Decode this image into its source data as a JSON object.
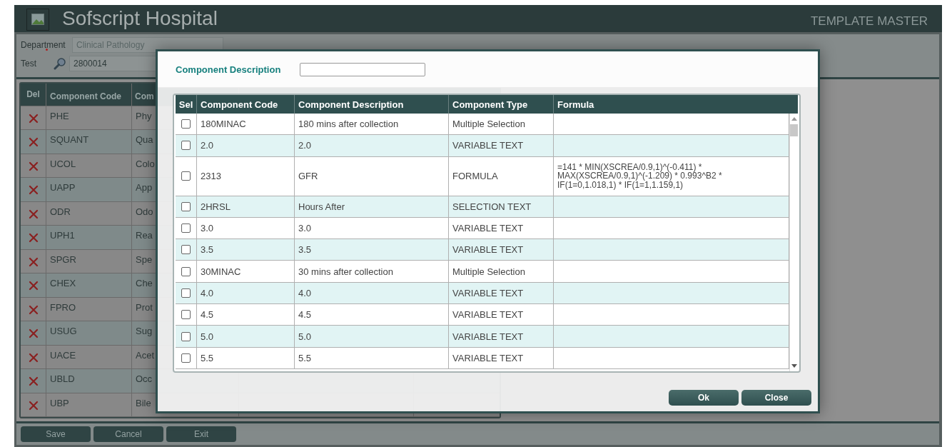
{
  "app": {
    "title": "Sofscript Hospital",
    "screen": "TEMPLATE MASTER"
  },
  "form": {
    "department": {
      "label": "Department",
      "required": true,
      "value": "Clinical Pathology"
    },
    "test": {
      "label": "Test",
      "value": "2800014"
    }
  },
  "component_table": {
    "columns": [
      "Del",
      "Component Code",
      "Com"
    ],
    "rows": [
      {
        "code": "PHE",
        "description": "Phy"
      },
      {
        "code": "SQUANT",
        "description": "Qua"
      },
      {
        "code": "UCOL",
        "description": "Colo"
      },
      {
        "code": "UAPP",
        "description": "App"
      },
      {
        "code": "ODR",
        "description": "Odo"
      },
      {
        "code": "UPH1",
        "description": "Rea"
      },
      {
        "code": "SPGR",
        "description": "Spe"
      },
      {
        "code": "CHEX",
        "description": "Che"
      },
      {
        "code": "FPRO",
        "description": "Prot"
      },
      {
        "code": "USUG",
        "description": "Sug"
      },
      {
        "code": "UACE",
        "description": "Acet"
      },
      {
        "code": "UBLD",
        "description": "Occ"
      },
      {
        "code": "UBP",
        "description": "Bile"
      }
    ]
  },
  "buttons": [
    "Save",
    "Cancel",
    "Exit"
  ],
  "dialog": {
    "filter": {
      "label": "Component Description"
    },
    "columns": [
      "Sel",
      "Component Code",
      "Component Description",
      "Component Type",
      "Formula"
    ],
    "rows": [
      {
        "checked": false,
        "code": "180MINAC",
        "description": "180 mins after collection",
        "type": "Multiple Selection"
      },
      {
        "checked": false,
        "code": "2.0",
        "description": "2.0",
        "type": "VARIABLE TEXT"
      },
      {
        "checked": false,
        "code": "2313",
        "description": "GFR",
        "type": "FORMULA",
        "formula": "=141 * MIN(XSCREA/0.9,1)^(-0.411) * MAX(XSCREA/0.9,1)^(-1.209) * 0.993^B2 * IF(1=0,1.018,1) * IF(1=1,1.159,1)"
      },
      {
        "checked": false,
        "code": "2HRSL",
        "description": "Hours After",
        "type": "SELECTION TEXT"
      },
      {
        "checked": false,
        "code": "3.0",
        "description": "3.0",
        "type": "VARIABLE TEXT"
      },
      {
        "checked": false,
        "code": "3.5",
        "description": "3.5",
        "type": "VARIABLE TEXT"
      },
      {
        "checked": false,
        "code": "30MINAC",
        "description": "30 mins after collection",
        "type": "Multiple Selection"
      },
      {
        "checked": false,
        "code": "4.0",
        "description": "4.0",
        "type": "VARIABLE TEXT"
      },
      {
        "checked": false,
        "code": "4.5",
        "description": "4.5",
        "type": "VARIABLE TEXT"
      },
      {
        "checked": false,
        "code": "5.0",
        "description": "5.0",
        "type": "VARIABLE TEXT"
      },
      {
        "checked": false,
        "code": "5.5",
        "description": "5.5",
        "type": "VARIABLE TEXT"
      }
    ],
    "buttons": [
      "Ok",
      "Close"
    ]
  }
}
